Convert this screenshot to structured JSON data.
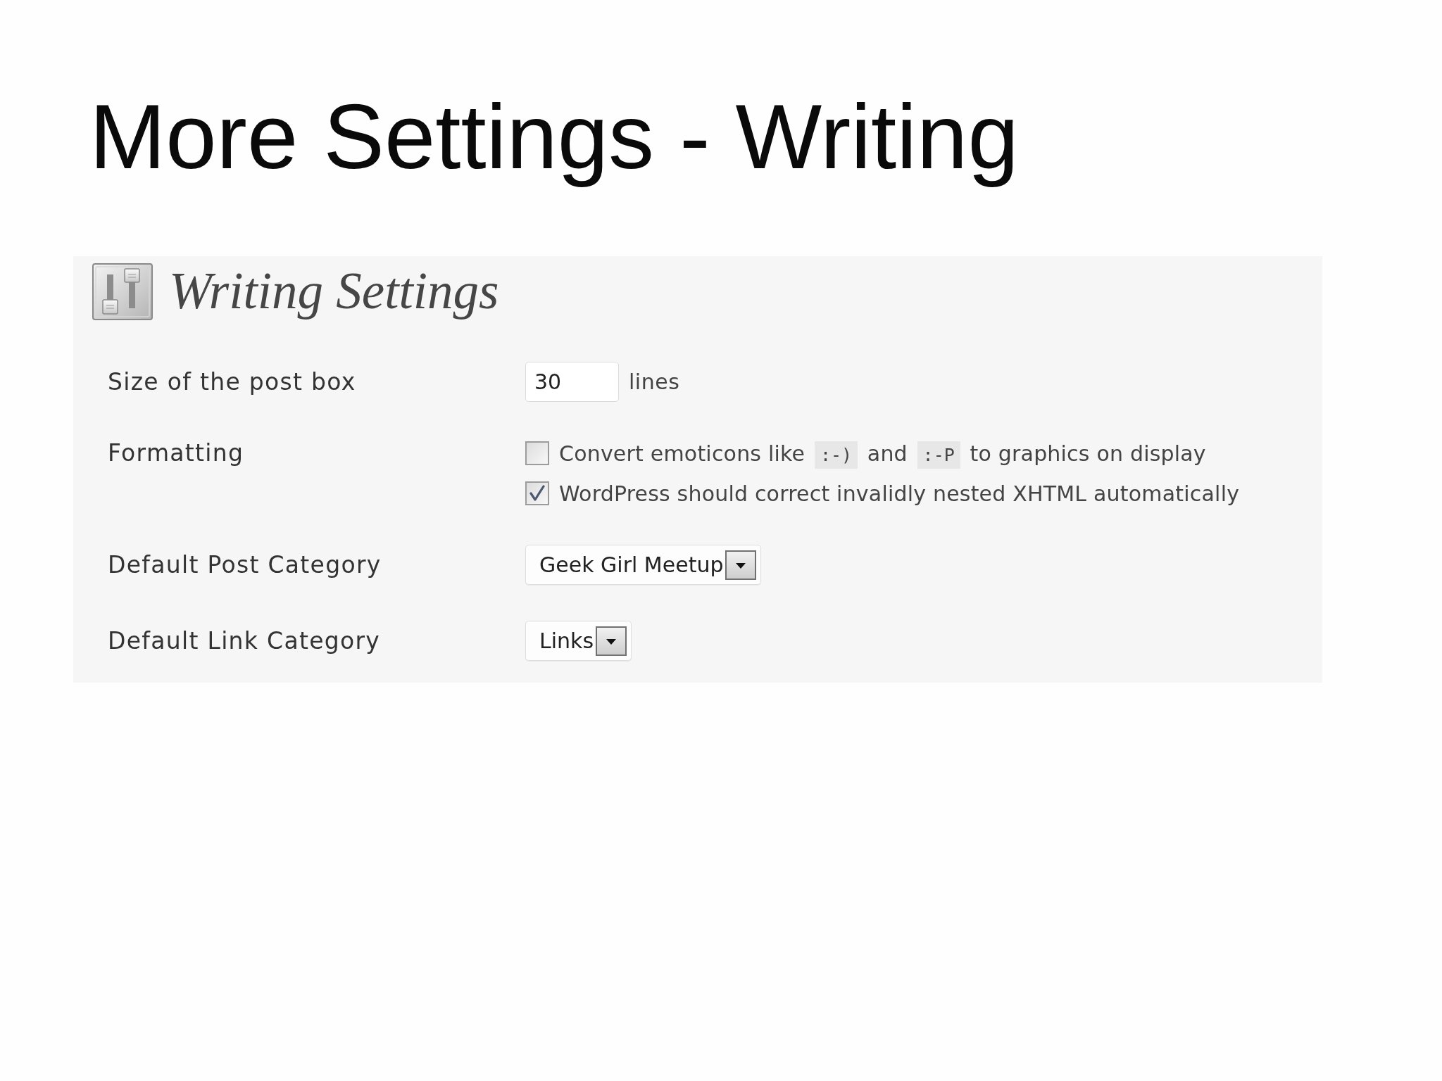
{
  "slide_title": "More Settings - Writing",
  "panel": {
    "title": "Writing Settings"
  },
  "settings": [
    {
      "kind": "number",
      "label": "Size of the post box",
      "value": "30",
      "unit": "lines"
    },
    {
      "kind": "checkboxes",
      "label": "Formatting",
      "options": [
        {
          "checked": false,
          "parts": [
            {
              "kind": "text",
              "text": "Convert emoticons like"
            },
            {
              "kind": "code",
              "text": ":-)"
            },
            {
              "kind": "text",
              "text": "and"
            },
            {
              "kind": "code",
              "text": ":-P"
            },
            {
              "kind": "text",
              "text": "to graphics on display"
            }
          ]
        },
        {
          "checked": true,
          "parts": [
            {
              "kind": "text",
              "text": "WordPress should correct invalidly nested XHTML automatically"
            }
          ]
        }
      ]
    },
    {
      "kind": "select",
      "label": "Default Post Category",
      "value": "Geek Girl Meetup"
    },
    {
      "kind": "select",
      "label": "Default Link Category",
      "value": "Links"
    }
  ]
}
